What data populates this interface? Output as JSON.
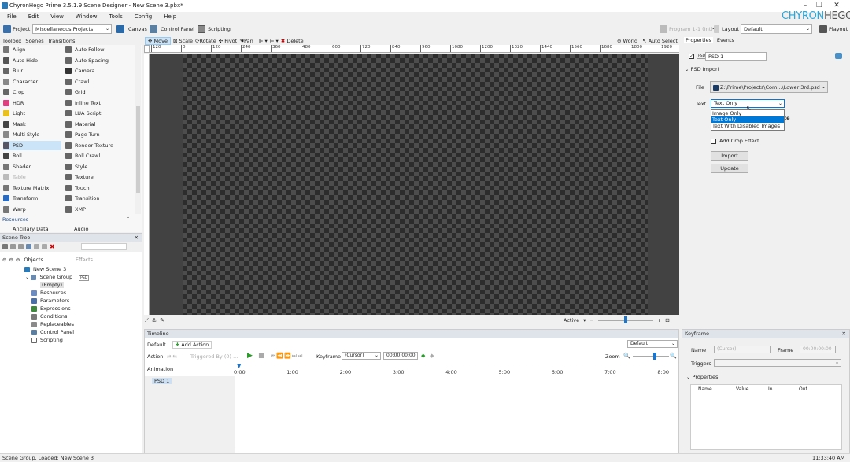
{
  "window": {
    "title": "ChyronHego Prime 3.5.1.9 Scene Designer - New Scene 3.pbx*",
    "minimize": "–",
    "maximize": "❐",
    "close": "✕"
  },
  "logo": {
    "left": "CHYRON",
    "right": "HEGO"
  },
  "menu": [
    "File",
    "Edit",
    "View",
    "Window",
    "Tools",
    "Config",
    "Help"
  ],
  "toolbar": {
    "project_label": "Project",
    "project_value": "Miscellaneous Projects",
    "canvas": "Canvas",
    "control_panel": "Control Panel",
    "scripting": "Scripting",
    "program": "Program 1-1 (Int)",
    "layout_label": "Layout",
    "layout_value": "Default",
    "playout": "Playout"
  },
  "left_tabs": [
    "Toolbox",
    "Scenes",
    "Transitions"
  ],
  "toolbox": {
    "col1": [
      {
        "label": "Align",
        "color": "#777"
      },
      {
        "label": "Auto Hide",
        "color": "#555"
      },
      {
        "label": "Blur",
        "color": "#666"
      },
      {
        "label": "Character",
        "color": "#888"
      },
      {
        "label": "Crop",
        "color": "#666"
      },
      {
        "label": "HDR",
        "color": "#e04080"
      },
      {
        "label": "Light",
        "color": "#e8c020"
      },
      {
        "label": "Mask",
        "color": "#444"
      },
      {
        "label": "Multi Style",
        "color": "#888"
      },
      {
        "label": "PSD",
        "color": "#556"
      },
      {
        "label": "Roll",
        "color": "#444"
      },
      {
        "label": "Shader",
        "color": "#777"
      },
      {
        "label": "Table",
        "color": "#bbb"
      },
      {
        "label": "Texture Matrix",
        "color": "#777"
      },
      {
        "label": "Transform",
        "color": "#2a6bc0"
      },
      {
        "label": "Warp",
        "color": "#777"
      }
    ],
    "col2": [
      {
        "label": "Auto Follow",
        "color": "#666"
      },
      {
        "label": "Auto Spacing",
        "color": "#666"
      },
      {
        "label": "Camera",
        "color": "#333"
      },
      {
        "label": "Crawl",
        "color": "#666"
      },
      {
        "label": "Grid",
        "color": "#666"
      },
      {
        "label": "Inline Text",
        "color": "#666"
      },
      {
        "label": "LUA Script",
        "color": "#666"
      },
      {
        "label": "Material",
        "color": "#666"
      },
      {
        "label": "Page Turn",
        "color": "#666"
      },
      {
        "label": "Render Texture",
        "color": "#666"
      },
      {
        "label": "Roll Crawl",
        "color": "#666"
      },
      {
        "label": "Style",
        "color": "#666"
      },
      {
        "label": "Texture",
        "color": "#666"
      },
      {
        "label": "Touch",
        "color": "#666"
      },
      {
        "label": "Transition",
        "color": "#666"
      },
      {
        "label": "XMP",
        "color": "#666"
      }
    ],
    "section": "Resources",
    "partial": [
      "Ancillary Data",
      "Audio"
    ]
  },
  "scene_tree": {
    "title": "Scene Tree",
    "col_objects": "Objects",
    "col_effects": "Effects",
    "items": [
      "New Scene 3",
      "Scene Group",
      "(Empty)",
      "Resources",
      "Parameters",
      "Expressions",
      "Conditions",
      "Replaceables",
      "Control Panel",
      "Scripting"
    ],
    "badge": "PSD"
  },
  "canvas_toolbar": {
    "move": "Move",
    "scale": "Scale",
    "rotate": "Rotate",
    "pivot": "Pivot",
    "pan": "Pan",
    "delete": "Delete",
    "world": "World",
    "auto_select": "Auto Select"
  },
  "ruler_h": [
    "120",
    "0",
    "120",
    "240",
    "360",
    "480",
    "600",
    "720",
    "840",
    "960",
    "1080",
    "1200",
    "1320",
    "1440",
    "1560",
    "1680",
    "1800",
    "1920"
  ],
  "canvas_status": {
    "active": "Active"
  },
  "timeline": {
    "title": "Timeline",
    "tab": "Default",
    "add_action": "Add Action",
    "dd_default": "Default",
    "action_label": "Action",
    "triggered_by": "Triggered By (0) ...",
    "keyframe_label": "Keyframe",
    "keyframe_value": "(Cursor)",
    "time_value": "00:00:00:00",
    "zoom_label": "Zoom",
    "animation_label": "Animation",
    "ticks": [
      "0:00",
      "1:00",
      "2:00",
      "3:00",
      "4:00",
      "5:00",
      "6:00",
      "7:00",
      "8:00"
    ],
    "track": "PSD 1"
  },
  "props_tabs": [
    "Properties",
    "Events"
  ],
  "props": {
    "name_badge": "PSD",
    "name_value": "PSD 1",
    "section": "PSD Import",
    "file_label": "File",
    "file_value": "Z:\\Prime\\Projects\\Com...\\Lower 3rd.psd",
    "text_label": "Text",
    "text_value": "Text Only",
    "options": [
      "Image Only",
      "Text Only",
      "Text With Disabled Images"
    ],
    "behind1": "te",
    "add_crop": "Add Crop Effect",
    "import": "Import",
    "update": "Update"
  },
  "keyframe": {
    "title": "Keyframe",
    "name_label": "Name",
    "name_value": "(Cursor)",
    "frame_label": "Frame",
    "frame_value": "00:00:00:00",
    "triggers_label": "Triggers",
    "properties": "Properties",
    "cols": [
      "Name",
      "Value",
      "In",
      "Out"
    ]
  },
  "status": {
    "left": "Scene Group, Loaded: New Scene 3",
    "right": "11:33:40 AM"
  }
}
